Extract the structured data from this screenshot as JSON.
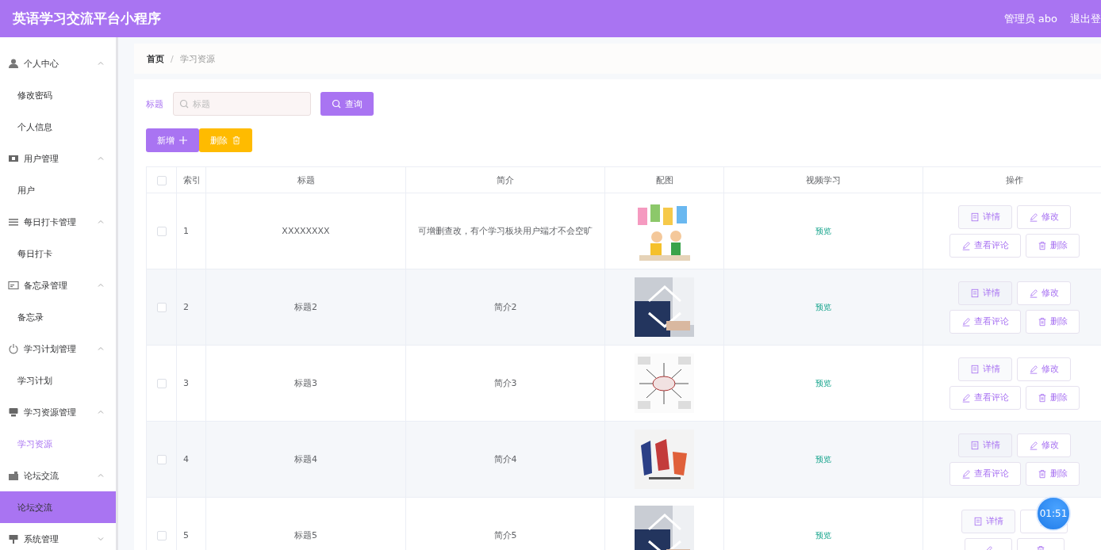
{
  "header": {
    "title": "英语学习交流平台小程序",
    "user": "管理员 abo",
    "logout": "退出登"
  },
  "sidebar": {
    "groups": [
      {
        "title": "个人中心",
        "expanded": true,
        "children": [
          {
            "label": "修改密码",
            "selected": false,
            "hovered": false
          },
          {
            "label": "个人信息",
            "selected": false,
            "hovered": false
          }
        ]
      },
      {
        "title": "用户管理",
        "expanded": true,
        "children": [
          {
            "label": "用户",
            "selected": false,
            "hovered": false
          }
        ]
      },
      {
        "title": "每日打卡管理",
        "expanded": true,
        "children": [
          {
            "label": "每日打卡",
            "selected": false,
            "hovered": false
          }
        ]
      },
      {
        "title": "备忘录管理",
        "expanded": true,
        "children": [
          {
            "label": "备忘录",
            "selected": false,
            "hovered": false
          }
        ]
      },
      {
        "title": "学习计划管理",
        "expanded": true,
        "children": [
          {
            "label": "学习计划",
            "selected": false,
            "hovered": false
          }
        ]
      },
      {
        "title": "学习资源管理",
        "expanded": true,
        "children": [
          {
            "label": "学习资源",
            "selected": true,
            "hovered": false
          }
        ]
      },
      {
        "title": "论坛交流",
        "expanded": true,
        "children": [
          {
            "label": "论坛交流",
            "selected": false,
            "hovered": true
          }
        ]
      },
      {
        "title": "系统管理",
        "expanded": false
      }
    ]
  },
  "breadcrumb": {
    "items": [
      "首页",
      "学习资源"
    ],
    "separator": "/"
  },
  "search": {
    "label": "标题",
    "placeholder": "标题",
    "button": "查询"
  },
  "toolbar": {
    "add": "新增",
    "delete": "删除"
  },
  "table": {
    "select_all": {
      "checked": false
    },
    "columns": [
      "索引",
      "标题",
      "简介",
      "配图",
      "视频学习",
      "操作"
    ],
    "rows": [
      {
        "checked": false,
        "index": "1",
        "title": "XXXXXXXX",
        "intro": "可增删查改，有个学习板块用户端才不会空旷",
        "image": {
          "kind": "picture"
        },
        "video": "预览",
        "actions": [
          {
            "kind": "detail",
            "label": "详情"
          },
          {
            "kind": "edit",
            "label": "修改"
          },
          {
            "kind": "comments",
            "label": "查看评论"
          },
          {
            "kind": "delete",
            "label": "删除"
          }
        ]
      },
      {
        "checked": false,
        "index": "2",
        "title": "标题2",
        "intro": "简介2",
        "image": {
          "kind": "picture"
        },
        "video": "预览",
        "actions": [
          {
            "kind": "detail",
            "label": "详情"
          },
          {
            "kind": "edit",
            "label": "修改"
          },
          {
            "kind": "comments",
            "label": "查看评论"
          },
          {
            "kind": "delete",
            "label": "删除"
          }
        ]
      },
      {
        "checked": false,
        "index": "3",
        "title": "标题3",
        "intro": "简介3",
        "image": {
          "kind": "picture"
        },
        "video": "预览",
        "actions": [
          {
            "kind": "detail",
            "label": "详情"
          },
          {
            "kind": "edit",
            "label": "修改"
          },
          {
            "kind": "comments",
            "label": "查看评论"
          },
          {
            "kind": "delete",
            "label": "删除"
          }
        ]
      },
      {
        "checked": false,
        "index": "4",
        "title": "标题4",
        "intro": "简介4",
        "image": {
          "kind": "picture"
        },
        "video": "预览",
        "actions": [
          {
            "kind": "detail",
            "label": "详情"
          },
          {
            "kind": "edit",
            "label": "修改"
          },
          {
            "kind": "comments",
            "label": "查看评论"
          },
          {
            "kind": "delete",
            "label": "删除"
          }
        ]
      },
      {
        "checked": false,
        "index": "5",
        "title": "标题5",
        "intro": "简介5",
        "image": {
          "kind": "picture"
        },
        "video": "预览",
        "actions": [
          {
            "kind": "detail",
            "label": "详情"
          },
          {
            "kind": "edit"
          },
          {
            "kind": "comments"
          },
          {
            "kind": "delete"
          }
        ]
      }
    ]
  },
  "timer": {
    "label": "01:51"
  }
}
